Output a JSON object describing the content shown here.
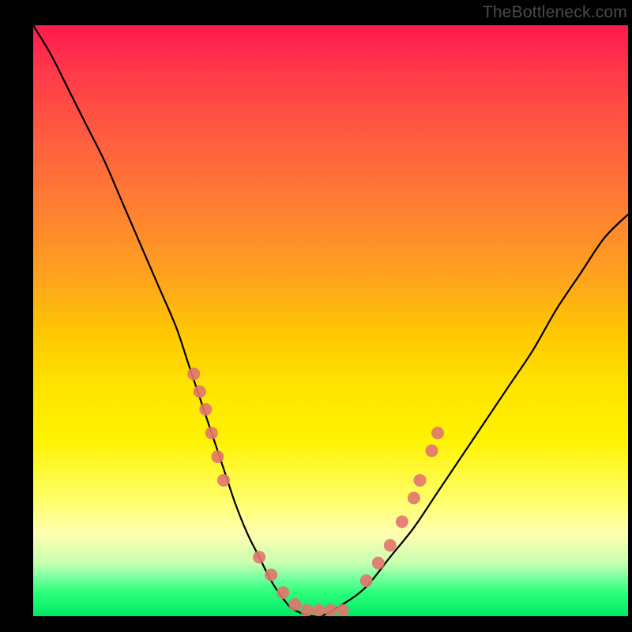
{
  "watermark": "TheBottleneck.com",
  "colors": {
    "curve": "#000000",
    "points": "#e2746e",
    "gradient_stops": [
      "#ff1a4d",
      "#ff3a4a",
      "#ff5a40",
      "#ff7d33",
      "#ffa020",
      "#ffc700",
      "#ffe600",
      "#fff200",
      "#ffff66",
      "#ffffb0",
      "#c8ffb0",
      "#66ff99",
      "#2dff7a",
      "#00e865"
    ]
  },
  "chart_data": {
    "type": "line",
    "title": "",
    "xlabel": "",
    "ylabel": "",
    "xlim": [
      0,
      100
    ],
    "ylim": [
      0,
      100
    ],
    "series": [
      {
        "name": "bottleneck-curve",
        "x": [
          0,
          3,
          6,
          9,
          12,
          15,
          18,
          21,
          24,
          26,
          28,
          30,
          32,
          34,
          36,
          38,
          40,
          42,
          44,
          48,
          52,
          56,
          60,
          64,
          68,
          72,
          76,
          80,
          84,
          88,
          92,
          96,
          100
        ],
        "y": [
          100,
          95,
          89,
          83,
          77,
          70,
          63,
          56,
          49,
          43,
          37,
          31,
          25,
          19,
          14,
          10,
          6,
          3,
          1,
          0,
          2,
          5,
          10,
          15,
          21,
          27,
          33,
          39,
          45,
          52,
          58,
          64,
          68
        ]
      }
    ],
    "points": [
      {
        "name": "left-cluster-1",
        "x": 27,
        "y": 41
      },
      {
        "name": "left-cluster-2",
        "x": 28,
        "y": 38
      },
      {
        "name": "left-cluster-3",
        "x": 29,
        "y": 35
      },
      {
        "name": "left-cluster-4",
        "x": 30,
        "y": 31
      },
      {
        "name": "left-cluster-5",
        "x": 31,
        "y": 27
      },
      {
        "name": "left-cluster-6",
        "x": 32,
        "y": 23
      },
      {
        "name": "bottom-1",
        "x": 38,
        "y": 10
      },
      {
        "name": "bottom-2",
        "x": 40,
        "y": 7
      },
      {
        "name": "bottom-3",
        "x": 42,
        "y": 4
      },
      {
        "name": "bottom-4",
        "x": 44,
        "y": 2
      },
      {
        "name": "bottom-5",
        "x": 46,
        "y": 1
      },
      {
        "name": "bottom-6",
        "x": 48,
        "y": 1
      },
      {
        "name": "bottom-7",
        "x": 50,
        "y": 1
      },
      {
        "name": "bottom-8",
        "x": 52,
        "y": 1
      },
      {
        "name": "right-cluster-1",
        "x": 56,
        "y": 6
      },
      {
        "name": "right-cluster-2",
        "x": 58,
        "y": 9
      },
      {
        "name": "right-cluster-3",
        "x": 60,
        "y": 12
      },
      {
        "name": "right-cluster-4",
        "x": 62,
        "y": 16
      },
      {
        "name": "right-cluster-5",
        "x": 64,
        "y": 20
      },
      {
        "name": "right-cluster-6",
        "x": 65,
        "y": 23
      },
      {
        "name": "right-cluster-7",
        "x": 67,
        "y": 28
      },
      {
        "name": "right-cluster-8",
        "x": 68,
        "y": 31
      }
    ]
  }
}
